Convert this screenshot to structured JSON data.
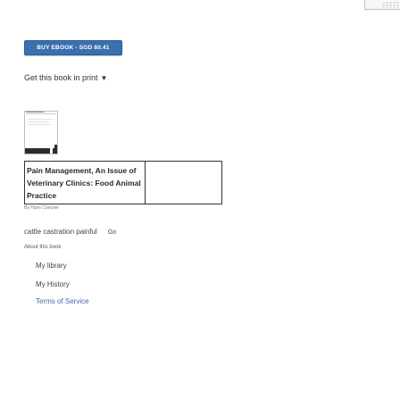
{
  "buy": {
    "label": "BUY EBOOK - SGD 80.41"
  },
  "print": {
    "label": "Get this book in print",
    "icon": "chevron-down-icon",
    "arrow_glyph": "▼"
  },
  "book": {
    "title_lines": [
      "Pain Management, An Issue of",
      "Veterinary Clinics: Food Animal",
      "Practice"
    ],
    "author": "By Hans Coetzee"
  },
  "search": {
    "query": "cattle castration painful",
    "go_label": "Go"
  },
  "links": {
    "about": "About this book",
    "my_library": "My library",
    "my_history": "My History",
    "terms": "Terms of Service"
  },
  "colors": {
    "accent": "#3a6fb0",
    "link": "#4a64a8"
  }
}
